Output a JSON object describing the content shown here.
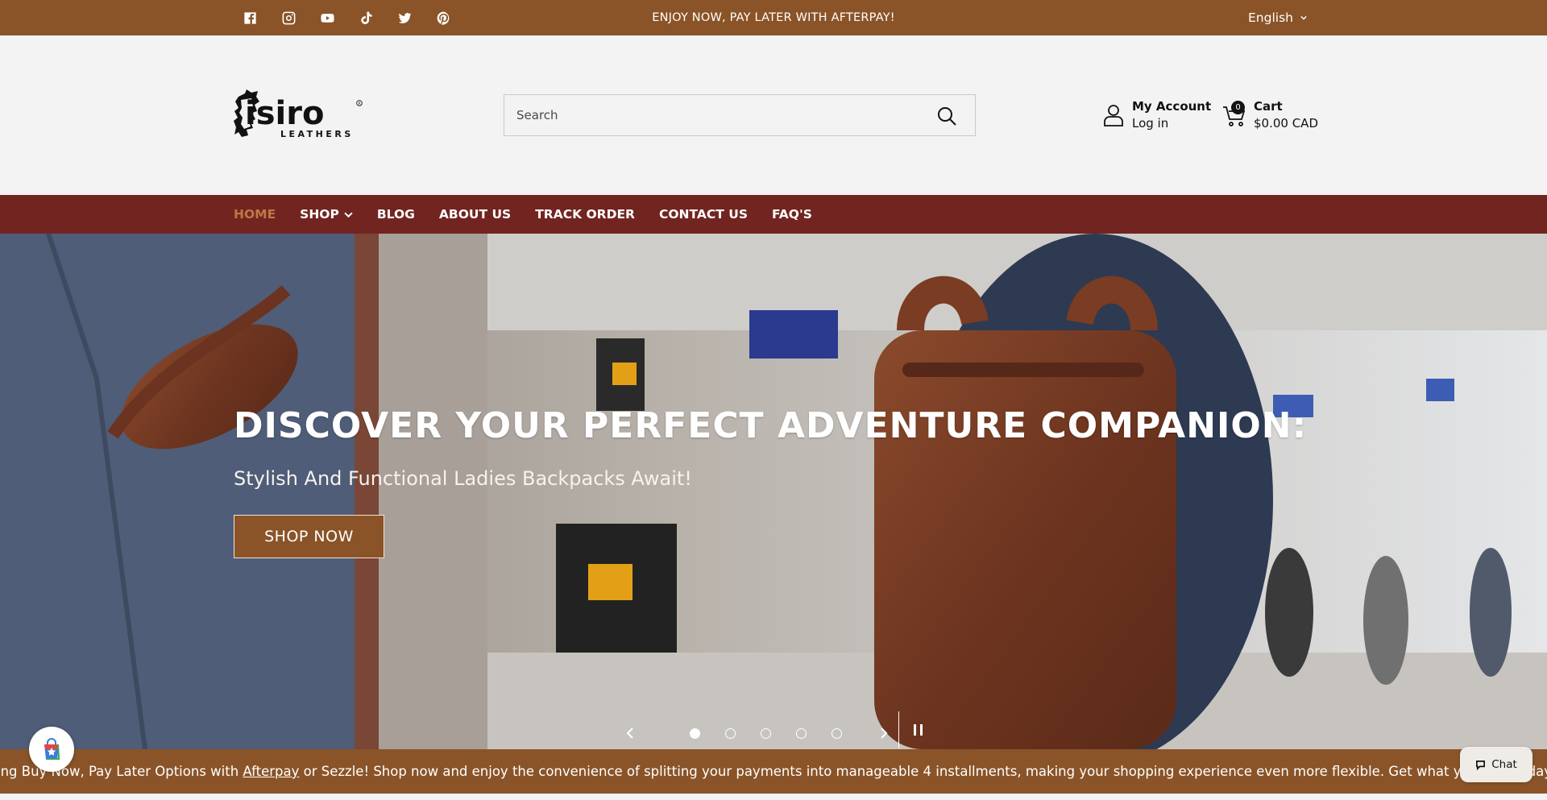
{
  "announcement": {
    "text": "ENJOY NOW, PAY LATER WITH AFTERPAY!",
    "language": "English",
    "social_icons": [
      "facebook-icon",
      "instagram-icon",
      "youtube-icon",
      "tiktok-icon",
      "twitter-icon",
      "pinterest-icon"
    ]
  },
  "header": {
    "logo_text": "isiro",
    "logo_subtext": "LEATHERS",
    "search_placeholder": "Search",
    "account_title": "My Account",
    "account_action": "Log in",
    "cart_label": "Cart",
    "cart_total": "$0.00 CAD",
    "cart_count": "0"
  },
  "nav": {
    "items": [
      {
        "label": "HOME",
        "active": true
      },
      {
        "label": "SHOP",
        "dropdown": true
      },
      {
        "label": "BLOG"
      },
      {
        "label": "ABOUT US"
      },
      {
        "label": "TRACK ORDER"
      },
      {
        "label": "CONTACT US"
      },
      {
        "label": "FAQ'S"
      }
    ]
  },
  "hero": {
    "title": "DISCOVER YOUR PERFECT ADVENTURE COMPANION:",
    "subtitle": "Stylish And Functional Ladies Backpacks Await!",
    "button_label": "SHOP NOW",
    "slide_count": 5,
    "active_slide": 1
  },
  "marquee": {
    "text_before": "ing Buy Now, Pay Later Options with ",
    "link_text": "Afterpay",
    "text_after": " or Sezzle! Shop now and enjoy the convenience of splitting your payments into manageable 4 installments, making your shopping experience even more flexible. Get what you love today a"
  },
  "chat": {
    "label": "Chat"
  },
  "colors": {
    "brand_brown": "#8a5428",
    "nav_red": "#722420",
    "active_nav": "#b97a45"
  }
}
